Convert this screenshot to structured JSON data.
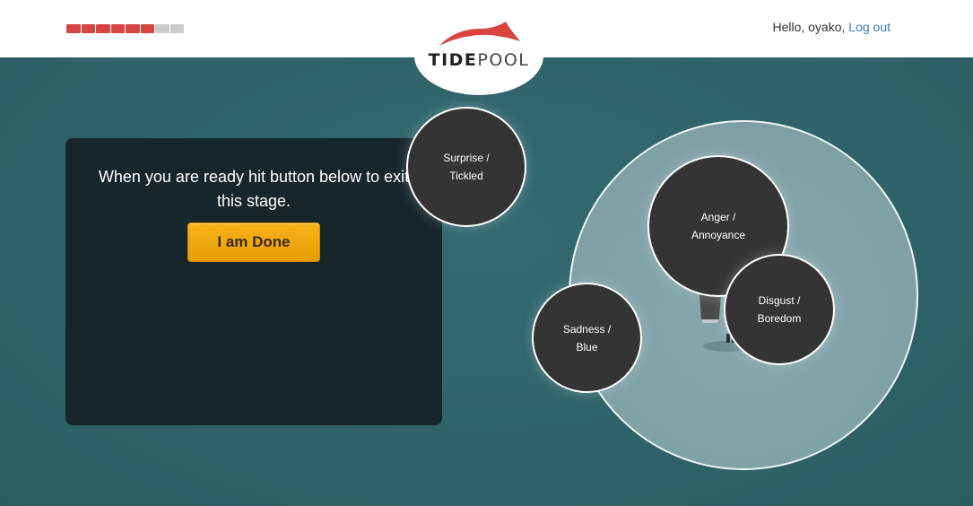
{
  "header": {
    "progress": {
      "filled": 6,
      "total": 8,
      "filled_color": "#d64541",
      "empty_color": "#cccccc"
    },
    "logo": {
      "part1": "TIDE",
      "part2": "POOL"
    },
    "greeting": "Hello, oyako,",
    "logout_label": "Log out",
    "logout_color": "#3b7fc4"
  },
  "panel": {
    "message": "When you are ready hit button below to exit this stage.",
    "done_label": "I am Done",
    "button_color": "#f2a90f"
  },
  "emotions": [
    {
      "line1": "Surprise /",
      "line2": "Tickled"
    },
    {
      "line1": "Anger /",
      "line2": "Annoyance"
    },
    {
      "line1": "Disgust /",
      "line2": "Boredom"
    },
    {
      "line1": "Sadness /",
      "line2": "Blue"
    }
  ]
}
